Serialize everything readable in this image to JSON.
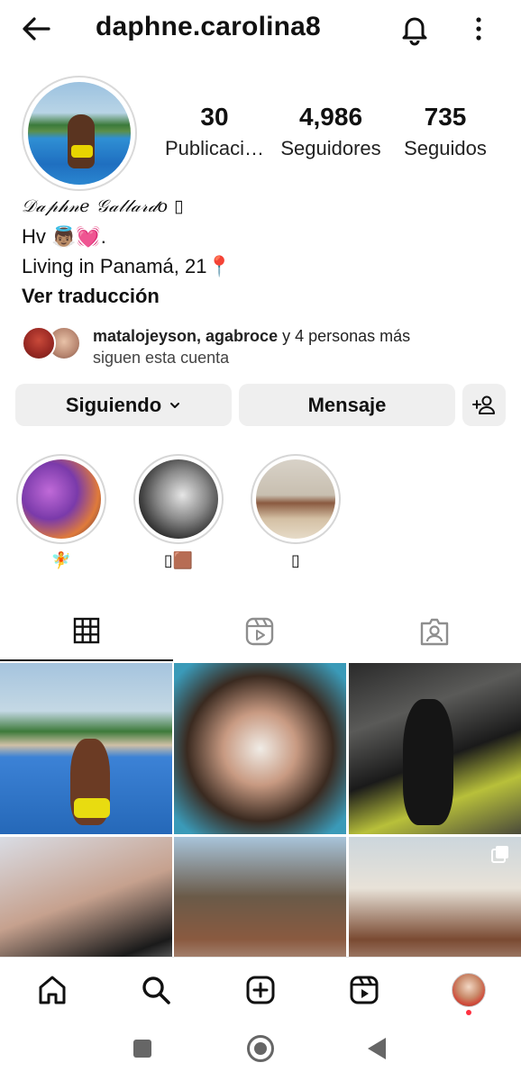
{
  "header": {
    "username": "daphne.carolina8",
    "icons": [
      "back-arrow-icon",
      "bell-icon",
      "more-vertical-icon"
    ]
  },
  "profile": {
    "stats": [
      {
        "value": "30",
        "label": "Publicaci…"
      },
      {
        "value": "4,986",
        "label": "Seguidores"
      },
      {
        "value": "735",
        "label": "Seguidos"
      }
    ]
  },
  "bio": {
    "display_name": "𝒟𝒶𝓅𝒽𝓃𝑒 𝒢𝒶𝓁𝓁𝒶𝓇𝒹𝑜 ▯",
    "line1": "Hv 👼🏽💓.",
    "line2": "Living in Panamá, 21📍",
    "translate": "Ver traducción"
  },
  "followed_by": {
    "names": "matalojeyson, agabroce",
    "rest": " y 4 personas más",
    "sub": "siguen esta cuenta"
  },
  "actions": {
    "following": "Siguiendo",
    "message": "Mensaje"
  },
  "highlights": [
    {
      "label": "🧚"
    },
    {
      "label": "▯🟫"
    },
    {
      "label": "▯"
    }
  ],
  "colors": {
    "button_bg": "#efefef",
    "notification_dot": "#ff3040",
    "text": "#111111"
  }
}
